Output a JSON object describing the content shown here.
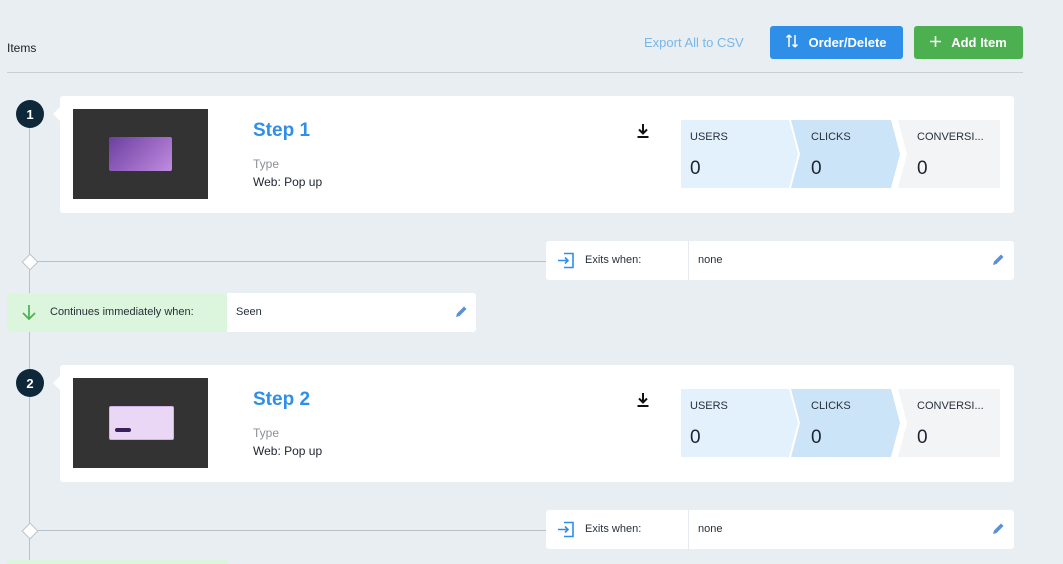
{
  "header": {
    "items_label": "Items",
    "export_label": "Export All to CSV",
    "order_delete_label": "Order/Delete",
    "add_item_label": "Add Item"
  },
  "icons": {
    "order": "sort-arrows-icon",
    "add": "plus-icon",
    "download": "download-icon",
    "exit": "exit-icon",
    "edit": "pencil-icon",
    "continue": "arrow-down-icon"
  },
  "colors": {
    "primary": "#2f8fe8",
    "success": "#4caf50",
    "step_badge": "#0e2839",
    "continue_bg": "#dcf5dd"
  },
  "steps": [
    {
      "number": "1",
      "title": "Step 1",
      "type_label": "Type",
      "type_value": "Web: Pop up",
      "metrics": [
        {
          "label": "USERS",
          "value": "0"
        },
        {
          "label": "CLICKS",
          "value": "0"
        },
        {
          "label": "CONVERSI...",
          "value": "0"
        }
      ],
      "exits_label": "Exits when:",
      "exits_value": "none"
    },
    {
      "number": "2",
      "title": "Step 2",
      "type_label": "Type",
      "type_value": "Web: Pop up",
      "metrics": [
        {
          "label": "USERS",
          "value": "0"
        },
        {
          "label": "CLICKS",
          "value": "0"
        },
        {
          "label": "CONVERSI...",
          "value": "0"
        }
      ],
      "exits_label": "Exits when:",
      "exits_value": "none"
    }
  ],
  "continues": {
    "label": "Continues immediately when:",
    "value": "Seen"
  }
}
